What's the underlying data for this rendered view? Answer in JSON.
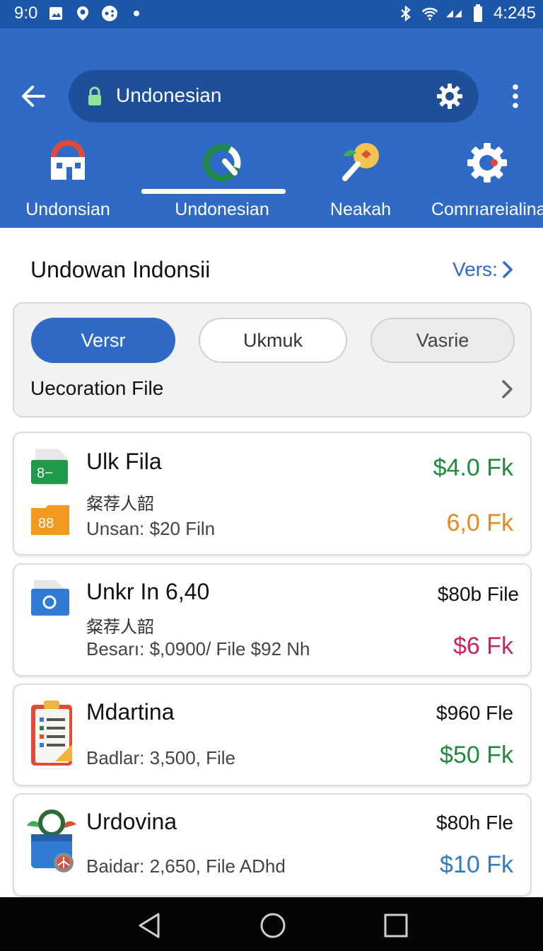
{
  "status_bar": {
    "time_left": "9:0",
    "time_right": "4:245",
    "icons_left": [
      "image-icon",
      "location-icon",
      "game-icon",
      "dot-icon"
    ],
    "icons_right": [
      "bluetooth-icon",
      "wifi-icon",
      "signal-icon",
      "battery-icon"
    ]
  },
  "app_bar": {
    "url_text": "Undonesian",
    "back_icon": "arrow-left-icon",
    "settings_icon": "gear-icon",
    "more_icon": "more-vert-icon",
    "accent_color": "#2f6bc6"
  },
  "nav_tabs": [
    {
      "label": "Undonsian",
      "icon": "store-icon"
    },
    {
      "label": "Undonesian",
      "icon": "refresh-icon",
      "selected": true
    },
    {
      "label": "Neakah",
      "icon": "search-leaf-icon"
    },
    {
      "label": "Comrıareialina",
      "icon": "gear-badge-icon"
    }
  ],
  "section": {
    "title": "Undowan Indonsii",
    "link": "Vers:"
  },
  "filters": {
    "chips": [
      "Versr",
      "Ukmuk",
      "Vasrie"
    ],
    "selected": "Versr",
    "row_label": "Uecoration File"
  },
  "items": [
    {
      "name": "Ulk Fila",
      "sub": "粲荐人韶",
      "meta": "Unsan: $20 Filn",
      "price_top": "$4.0 Fk",
      "price_top_color": "#1e8a3c",
      "price_bottom": "6,0 Fk",
      "price_bottom_color": "#e6891c",
      "icon": "spreadsheet-icon",
      "icon2": "folder-icon"
    },
    {
      "name": "Unkr In 6,40",
      "sub": "粲荐人韶",
      "meta": "Besarı: $,0900/ File $92 Nh",
      "price_top": "$80b File",
      "price_bottom": "$6 Fk",
      "price_bottom_color": "#c8265a",
      "icon": "document-icon"
    },
    {
      "name": "Mdartina",
      "meta": "Badlar: 3,500, File",
      "price_top": "$960 Fle",
      "price_bottom": "$50 Fk",
      "price_bottom_color": "#1e8a3c",
      "icon": "checklist-icon"
    },
    {
      "name": "Urdovina",
      "meta": "Baidar: 2,650, File ADhd",
      "price_top": "$80h Fle",
      "price_bottom": "$10 Fk",
      "price_bottom_color": "#2f7bc6",
      "icon": "package-icon"
    }
  ],
  "system_nav": [
    "back-triangle-icon",
    "home-circle-icon",
    "recents-square-icon"
  ]
}
